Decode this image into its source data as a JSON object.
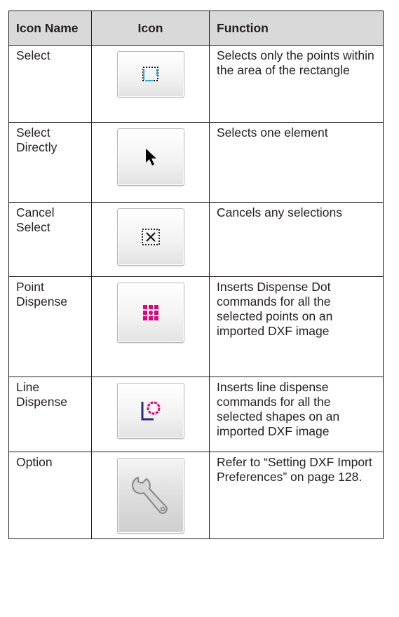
{
  "headers": {
    "name": "Icon Name",
    "icon": "Icon",
    "function": "Function"
  },
  "rows": [
    {
      "name": "Select",
      "icon": "select-rectangle-icon",
      "function": "Selects only the points within the area of the rectangle"
    },
    {
      "name": "Select Directly",
      "icon": "arrow-pointer-icon",
      "function": "Selects one element"
    },
    {
      "name": "Cancel Select",
      "icon": "cancel-select-icon",
      "function": "Cancels any selections"
    },
    {
      "name": "Point Dispense",
      "icon": "dot-grid-icon",
      "function": "Inserts Dispense Dot commands for all the selected points on an imported DXF image"
    },
    {
      "name": "Line Dispense",
      "icon": "line-circle-icon",
      "function": "Inserts line dispense commands for all the selected shapes on an imported DXF image"
    },
    {
      "name": "Option",
      "icon": "wrench-icon",
      "function": "Refer to “Setting DXF Import Preferences” on page 128."
    }
  ],
  "colors": {
    "border": "#231f20",
    "header_bg": "#d9d9d9",
    "select_blue": "#29a9e1",
    "dispense_magenta": "#e6007e",
    "line_navy": "#2e2a78"
  }
}
